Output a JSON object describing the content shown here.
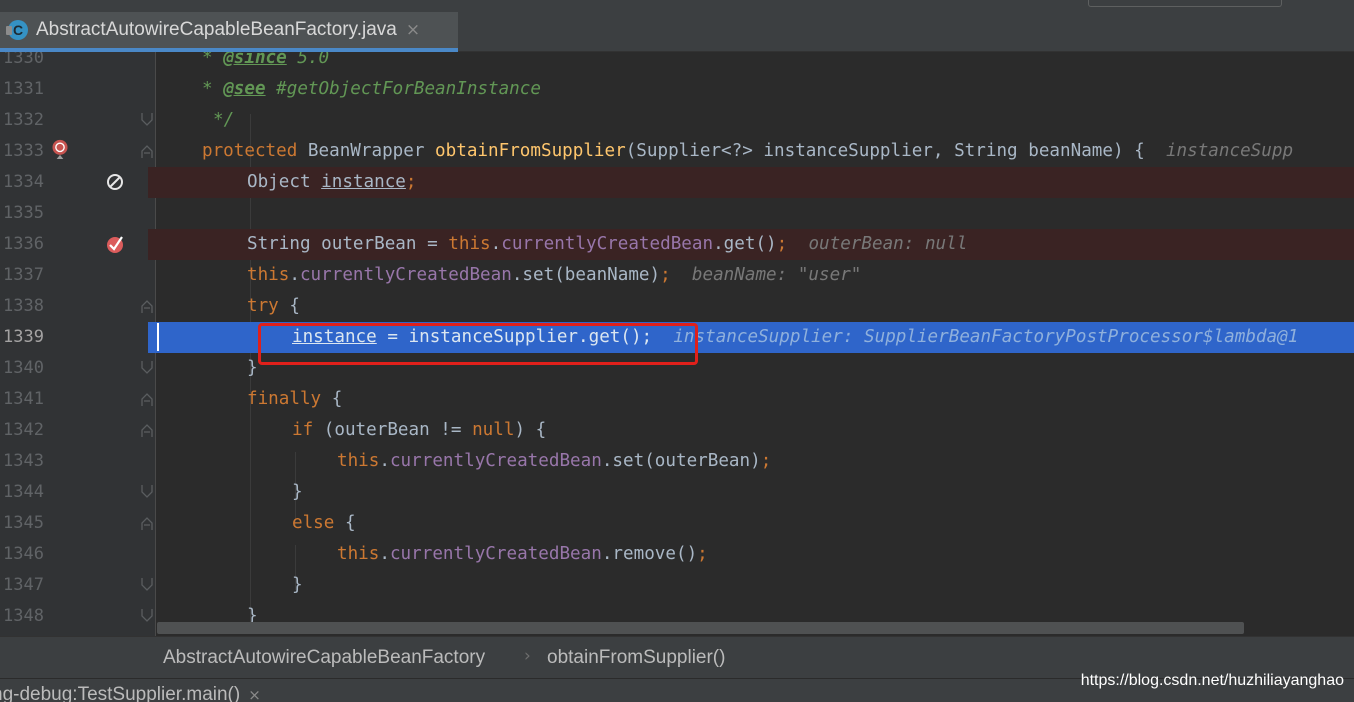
{
  "tab": {
    "icon_letter": "C",
    "title": "AbstractAutowireCapableBeanFactory.java",
    "close": "×"
  },
  "lines": {
    "l1330": {
      "num": "1330"
    },
    "l1331": {
      "num": "1331"
    },
    "l1332": {
      "num": "1332"
    },
    "l1333": {
      "num": "1333"
    },
    "l1334": {
      "num": "1334"
    },
    "l1335": {
      "num": "1335"
    },
    "l1336": {
      "num": "1336"
    },
    "l1337": {
      "num": "1337"
    },
    "l1338": {
      "num": "1338"
    },
    "l1339": {
      "num": "1339"
    },
    "l1340": {
      "num": "1340"
    },
    "l1341": {
      "num": "1341"
    },
    "l1342": {
      "num": "1342"
    },
    "l1343": {
      "num": "1343"
    },
    "l1344": {
      "num": "1344"
    },
    "l1345": {
      "num": "1345"
    },
    "l1346": {
      "num": "1346"
    },
    "l1347": {
      "num": "1347"
    },
    "l1348": {
      "num": "1348"
    }
  },
  "code": {
    "comment_star": "* ",
    "since_tag": "@since",
    "since_value": " 5.0",
    "see_tag": "@see",
    "see_value": " #getObjectForBeanInstance",
    "comment_end": "*/",
    "kw_protected": "protected",
    "type_beanwrapper": " BeanWrapper ",
    "method_obtain": "obtainFromSupplier",
    "params": "(Supplier<?> instanceSupplier, String beanName) {",
    "hint_1333": "instanceSupp",
    "type_object": "Object ",
    "var_instance": "instance",
    "semi": ";",
    "type_string": "String outerBean = ",
    "kw_this": "this",
    "dot": ".",
    "field_ccb": "currentlyCreatedBean",
    "call_get": ".get()",
    "hint_1336": "outerBean: null",
    "call_set_beanname": ".set(beanName)",
    "hint_1337": "beanName: \"user\"",
    "kw_try": "try",
    "brace_open": " {",
    "assign_call": " = instanceSupplier.get();",
    "hint_1339": "instanceSupplier: SupplierBeanFactoryPostProcessor$lambda@1",
    "brace_close": "}",
    "kw_finally": "finally",
    "kw_if": "if",
    "cond_open": " (outerBean != ",
    "kw_null": "null",
    "cond_close": ") {",
    "call_set_outer": ".set(outerBean)",
    "kw_else": "else",
    "call_remove": ".remove()"
  },
  "breadcrumb": {
    "class": "AbstractAutowireCapableBeanFactory",
    "separator": "›",
    "method": "obtainFromSupplier()"
  },
  "debug": {
    "label": "ng-debug:TestSupplier.main()",
    "close": "×"
  },
  "watermark": "https://blog.csdn.net/huzhiliayanghao",
  "colors": {
    "editor_bg": "#2b2b2b",
    "keyword": "#cc7832",
    "field": "#9876aa",
    "method": "#ffc66d",
    "comment": "#629755",
    "exec_line": "#2f65ca",
    "breakpoint_line": "#3a2323",
    "highlight_box": "#e0201b"
  }
}
